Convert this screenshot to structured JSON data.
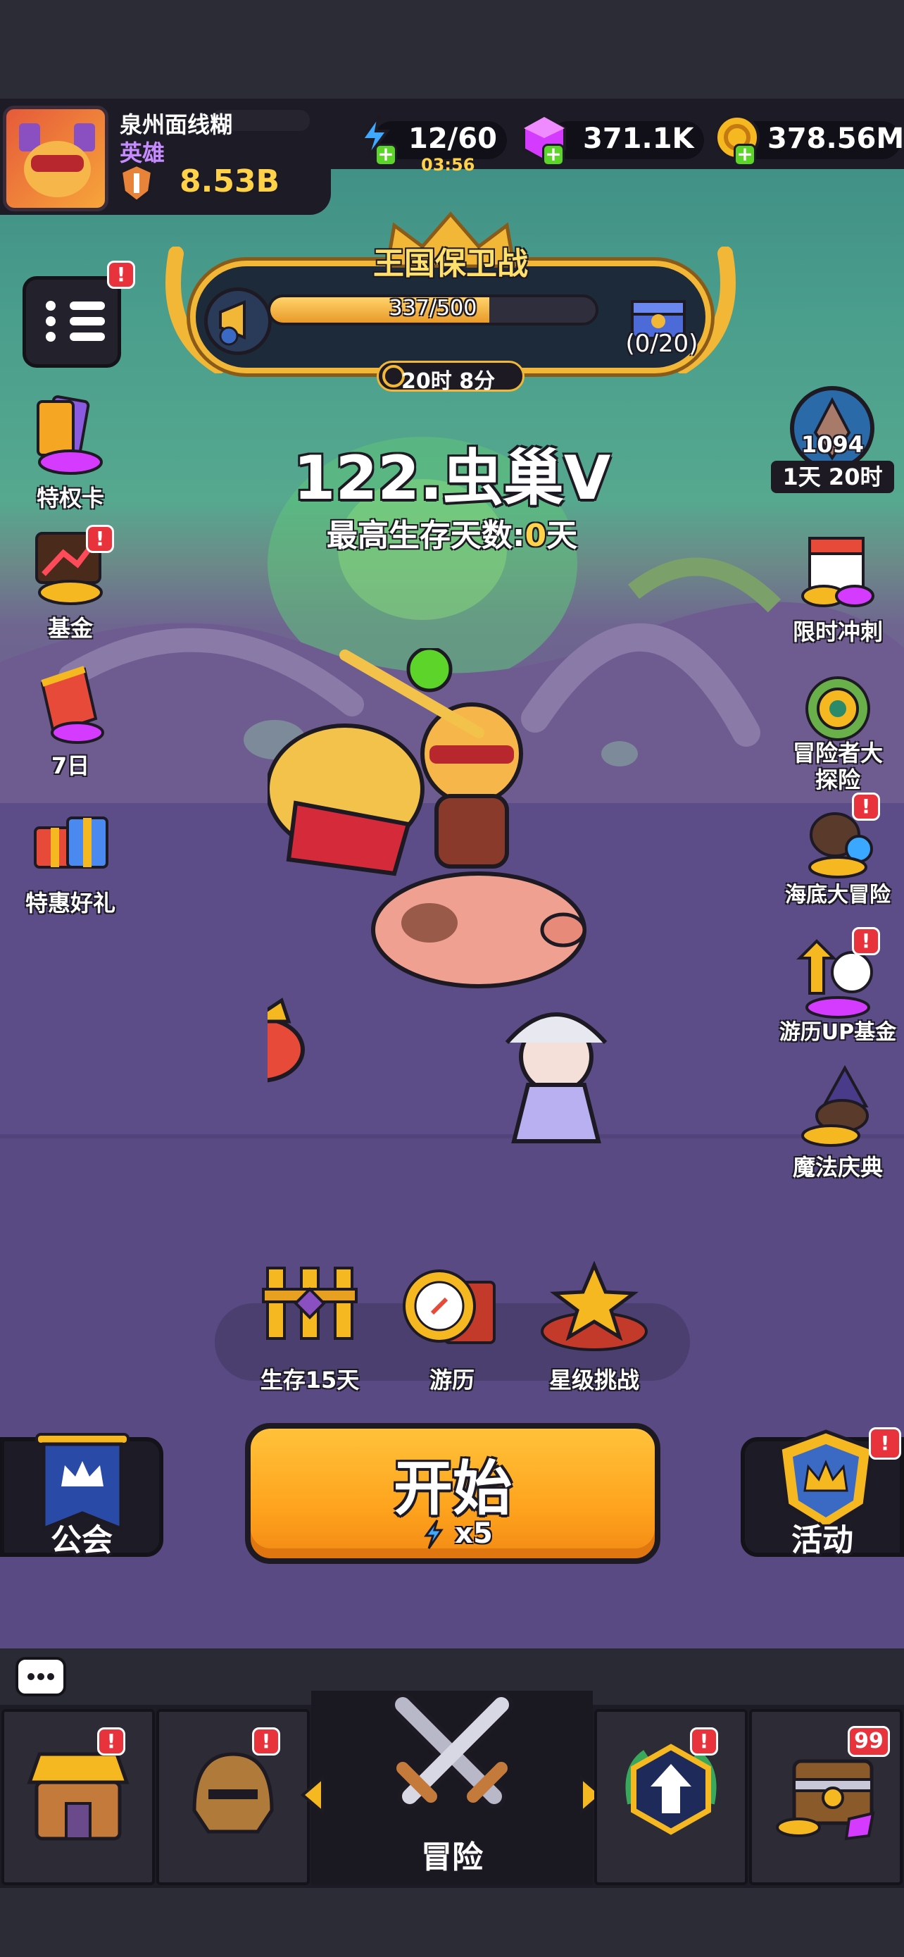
{
  "header": {
    "player_name": "泉州面线糊",
    "rank": "英雄",
    "power": "8.53B",
    "energy": "12/60",
    "energy_timer": "03:56",
    "gems": "371.1K",
    "gold": "378.56M",
    "plus_symbol": "+"
  },
  "event_banner": {
    "title": "王国保卫战",
    "progress_text": "337/500",
    "progress_fraction": 0.674,
    "chest_count": "(0/20)",
    "timer": "20时 8分"
  },
  "stage": {
    "title": "122.虫巢Ⅴ",
    "survival_prefix": "最高生存天数:",
    "survival_value": "0",
    "survival_suffix": "天"
  },
  "rank_widget": {
    "number": "1094",
    "time": "1天 20时"
  },
  "left_side": [
    {
      "label": "特权卡",
      "icon": "privilege-card-icon"
    },
    {
      "label": "基金",
      "icon": "fund-icon"
    },
    {
      "label": "7日",
      "icon": "seven-day-icon"
    },
    {
      "label": "特惠好礼",
      "icon": "special-gift-icon"
    }
  ],
  "right_side": [
    {
      "label": "限时冲刺",
      "icon": "calendar-icon"
    },
    {
      "label": "冒险者大\n探险",
      "icon": "compass-icon"
    },
    {
      "label": "海底大冒险",
      "icon": "diver-icon"
    },
    {
      "label": "游历UP基金",
      "icon": "arrow-up-compass-icon"
    },
    {
      "label": "魔法庆典",
      "icon": "wizard-icon"
    }
  ],
  "modes": [
    {
      "label": "生存15天",
      "icon": "gate-icon"
    },
    {
      "label": "游历",
      "icon": "compass-book-icon"
    },
    {
      "label": "星级挑战",
      "icon": "star-trophy-icon"
    }
  ],
  "start_button": {
    "label": "开始",
    "cost": "x5"
  },
  "guild_button": {
    "label": "公会"
  },
  "event_button": {
    "label": "活动"
  },
  "badges": {
    "alert": "!",
    "chest_count": "99"
  },
  "bottom_nav": {
    "active_label": "冒险"
  },
  "colors": {
    "accent_gold": "#ffd24a",
    "rank_purple": "#c68cff",
    "start_orange": "#ffa41e",
    "badge_red": "#e8333c"
  }
}
